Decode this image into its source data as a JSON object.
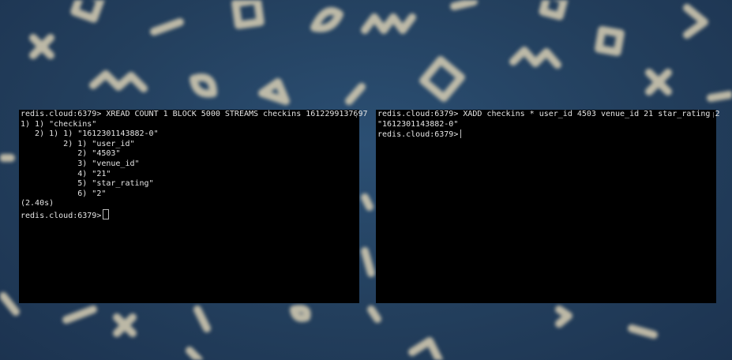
{
  "left_terminal": {
    "lines": [
      "redis.cloud:6379> XREAD COUNT 1 BLOCK 5000 STREAMS checkins 1612299137697",
      "1) 1) \"checkins\"",
      "   2) 1) 1) \"1612301143882-0\"",
      "         2) 1) \"user_id\"",
      "            2) \"4503\"",
      "            3) \"venue_id\"",
      "            4) \"21\"",
      "            5) \"star_rating\"",
      "            6) \"2\"",
      "(2.40s)"
    ],
    "prompt": "redis.cloud:6379>"
  },
  "right_terminal": {
    "lines": [
      "redis.cloud:6379> XADD checkins * user_id 4503 venue_id 21 star_rating 2",
      "\"1612301143882-0\""
    ],
    "prompt": "redis.cloud:6379>"
  },
  "background": {
    "color": "#233f5d",
    "shape_color": "#d9cfb4"
  }
}
